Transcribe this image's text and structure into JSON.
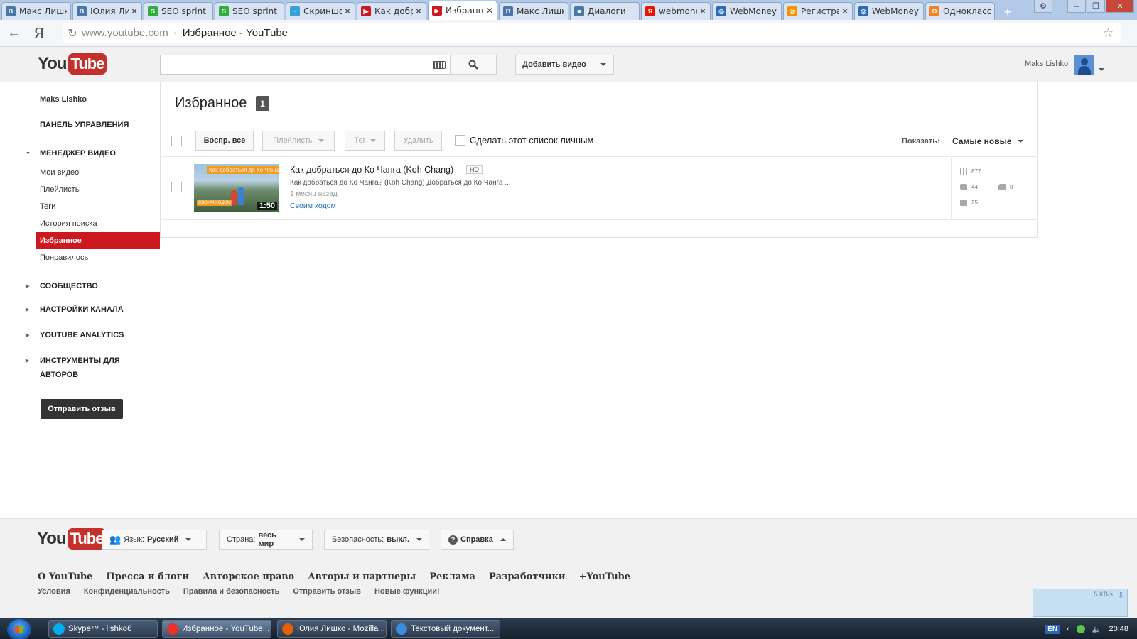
{
  "browser": {
    "tabs": [
      {
        "title": "Макс Лишко",
        "icon": "vk-icon",
        "color": "#4a76a8",
        "glyph": "B",
        "active": false,
        "closable": false
      },
      {
        "title": "Юлия Лишко",
        "icon": "vk-icon",
        "color": "#4a76a8",
        "glyph": "В",
        "active": false,
        "closable": true
      },
      {
        "title": "SEO sprint",
        "icon": "seosprint-icon",
        "color": "#2fae3a",
        "glyph": "S",
        "active": false,
        "closable": false
      },
      {
        "title": "SEO sprint",
        "icon": "seosprint-icon",
        "color": "#2fae3a",
        "glyph": "S",
        "active": false,
        "closable": false
      },
      {
        "title": "Скриншоты",
        "icon": "screenshot-icon",
        "color": "#35a2d8",
        "glyph": "~",
        "active": false,
        "closable": true
      },
      {
        "title": "Как добраться",
        "icon": "youtube-icon",
        "color": "#cc181e",
        "glyph": "▶",
        "active": false,
        "closable": true
      },
      {
        "title": "Избранное",
        "icon": "youtube-icon",
        "color": "#cc181e",
        "glyph": "▶",
        "active": true,
        "closable": true
      },
      {
        "title": "Макс Лишко",
        "icon": "vk-icon",
        "color": "#4a76a8",
        "glyph": "B",
        "active": false,
        "closable": false
      },
      {
        "title": "Диалоги",
        "icon": "vk-dialogs-icon",
        "color": "#4a76a8",
        "glyph": "■",
        "active": false,
        "closable": false
      },
      {
        "title": "webmoney",
        "icon": "yandex-icon",
        "color": "#e61400",
        "glyph": "Я",
        "active": false,
        "closable": true
      },
      {
        "title": "WebMoney",
        "icon": "globe-icon",
        "color": "#2b6ab7",
        "glyph": "◎",
        "active": false,
        "closable": false
      },
      {
        "title": "Регистрация",
        "icon": "mailru-icon",
        "color": "#f29400",
        "glyph": "@",
        "active": false,
        "closable": true
      },
      {
        "title": "WebMoney",
        "icon": "globe-icon",
        "color": "#2b6ab7",
        "glyph": "◎",
        "active": false,
        "closable": false
      },
      {
        "title": "Одноклассники",
        "icon": "odnoklassniki-icon",
        "color": "#f58220",
        "glyph": "О",
        "active": false,
        "closable": false
      }
    ],
    "new_tab_label": "+",
    "window_buttons": {
      "settings": "⚙",
      "minimize": "–",
      "maximize": "❐",
      "close": "✕"
    },
    "back_glyph": "←",
    "yandex_glyph": "Я",
    "reload_glyph": "↻",
    "url_host": "www.youtube.com",
    "url_separator": "›",
    "url_title": "Избранное - YouTube",
    "bookmark_glyph": "☆"
  },
  "header": {
    "logo_you": "You",
    "logo_tube": "Tube",
    "search_placeholder": "",
    "upload_label": "Добавить видео",
    "username": "Maks Lishko"
  },
  "sidebar": {
    "user": "Maks Lishko",
    "dashboard": "ПАНЕЛЬ УПРАВЛЕНИЯ",
    "video_manager": "МЕНЕДЖЕР ВИДЕО",
    "items": [
      {
        "label": "Мои видео",
        "active": false
      },
      {
        "label": "Плейлисты",
        "active": false
      },
      {
        "label": "Теги",
        "active": false
      },
      {
        "label": "История поиска",
        "active": false
      },
      {
        "label": "Избранное",
        "active": true
      },
      {
        "label": "Понравилось",
        "active": false
      }
    ],
    "community": "СООБЩЕСТВО",
    "channel_settings": "НАСТРОЙКИ КАНАЛА",
    "analytics": "YOUTUBE ANALYTICS",
    "creator_tools_1": "ИНСТРУМЕНТЫ ДЛЯ",
    "creator_tools_2": "АВТОРОВ",
    "feedback": "Отправить отзыв"
  },
  "main": {
    "title": "Избранное",
    "count": "1",
    "toolbar": {
      "play_all": "Воспр. все",
      "playlists": "Плейлисты",
      "tag": "Тег",
      "delete": "Удалить",
      "make_private": "Сделать этот список личным",
      "show_label": "Показать:",
      "sort": "Самые новые"
    },
    "videos": [
      {
        "thumb_title": "Как добраться до Ко Чанга?",
        "thumb_brand": "СВОИМ ХОДОМ",
        "duration": "1:50",
        "title": "Как добраться до Ко Чанга (Koh Chang)",
        "hd": "HD",
        "description": "Как добраться до Ко Чанга? (Koh Chang) Добраться до Ко Чанга ...",
        "age": "1 месяц назад",
        "channel": "Своим ходом",
        "views": "877",
        "likes": "44",
        "dislikes": "0",
        "comments": "25"
      }
    ]
  },
  "footer": {
    "logo_you": "You",
    "logo_tube": "Tube",
    "language_label": "Язык:",
    "language_value": "Русский",
    "country_label": "Страна:",
    "country_value": "весь мир",
    "safety_label": "Безопасность:",
    "safety_value": "выкл.",
    "help": "Справка",
    "links_primary": [
      "О YouTube",
      "Пресса и блоги",
      "Авторское право",
      "Авторы и партнеры",
      "Реклама",
      "Разработчики",
      "+YouTube"
    ],
    "links_secondary": [
      "Условия",
      "Конфиденциальность",
      "Правила и безопасность",
      "Отправить отзыв",
      "Новые функции!"
    ],
    "net_speed": "5 KB/s"
  },
  "taskbar": {
    "tasks": [
      {
        "label": "Skype™ - lishko6",
        "icon": "skype-icon",
        "color": "#00aff0",
        "active": false
      },
      {
        "label": "Избранное - YouTube...",
        "icon": "yandex-browser-icon",
        "color": "#e8322a",
        "active": true
      },
      {
        "label": "Юлия Лишко - Mozilla ...",
        "icon": "firefox-icon",
        "color": "#e66000",
        "active": false
      },
      {
        "label": "Текстовый документ...",
        "icon": "notepad-icon",
        "color": "#3b8de0",
        "active": false
      }
    ],
    "lang": "EN",
    "clock": "20:48"
  }
}
